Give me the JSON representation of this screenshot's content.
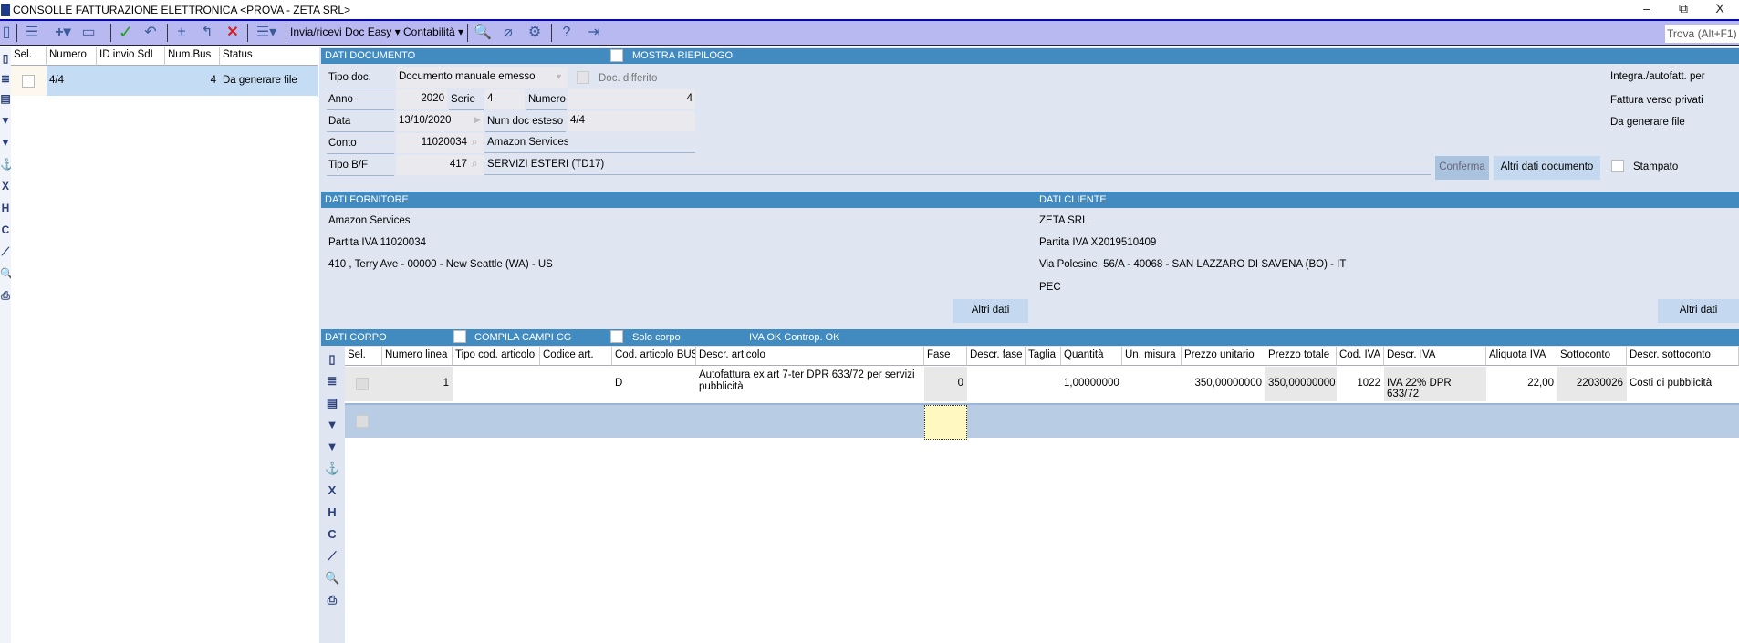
{
  "window": {
    "title": "CONSOLLE FATTURAZIONE ELETTRONICA <PROVA - ZETA SRL>",
    "minimize": "–",
    "restore": "⧉",
    "close": "X"
  },
  "toolbar": {
    "menu_doc_easy": "Invia/ricevi Doc Easy ▾",
    "menu_contabilita": "Contabilità ▾",
    "search_placeholder": "Trova (Alt+F1)"
  },
  "left_grid": {
    "columns": [
      "Sel.",
      "Numero",
      "ID invio SdI",
      "Num.Bus",
      "Status"
    ],
    "rows": [
      {
        "numero": "4/4",
        "id_invio": "",
        "num_bus": "4",
        "status": "Da generare file"
      }
    ]
  },
  "dati_documento": {
    "header": "DATI DOCUMENTO",
    "mostra_riepilogo": "MOSTRA RIEPILOGO",
    "tipo_doc_label": "Tipo doc.",
    "tipo_doc": "Documento manuale emesso",
    "doc_differito": "Doc. differito",
    "anno_label": "Anno",
    "anno": "2020",
    "serie_label": "Serie",
    "serie": "4",
    "numero_label": "Numero",
    "numero": "4",
    "data_label": "Data",
    "data": "13/10/2020",
    "num_doc_esteso_label": "Num doc esteso",
    "num_doc_esteso": "4/4",
    "conto_label": "Conto",
    "conto": "11020034",
    "conto_descr": "Amazon Services",
    "tipo_bf_label": "Tipo B/F",
    "tipo_bf": "417",
    "tipo_bf_descr": "SERVIZI ESTERI (TD17)",
    "conferma": "Conferma",
    "altri_dati_documento": "Altri dati documento",
    "stampato": "Stampato",
    "info": [
      "Integra./autofatt. per",
      "Fattura verso privati",
      "Da generare file"
    ]
  },
  "fornitore": {
    "header": "DATI FORNITORE",
    "nome": "Amazon Services",
    "piva": "Partita IVA 11020034",
    "indirizzo": "410 , Terry Ave - 00000 - New Seattle (WA)  - US",
    "altri_dati": "Altri dati"
  },
  "cliente": {
    "header": "DATI CLIENTE",
    "nome": "ZETA SRL",
    "piva": "Partita IVA X2019510409",
    "indirizzo": "Via Polesine, 56/A - 40068 - SAN LAZZARO DI SAVENA (BO)  - IT",
    "pec": "PEC",
    "altri_dati": "Altri dati"
  },
  "corpo": {
    "header": "DATI CORPO",
    "compila": "COMPILA CAMPI CG",
    "solo_corpo": "Solo corpo",
    "iva_ok": "IVA OK Controp. OK",
    "columns": [
      "Sel.",
      "Numero linea",
      "Tipo cod. articolo",
      "Codice art.",
      "Cod. articolo BUS",
      "Descr. articolo",
      "Fase",
      "Descr. fase",
      "Taglia",
      "Quantità",
      "Un. misura",
      "Prezzo unitario",
      "Prezzo totale",
      "Cod. IVA",
      "Descr. IVA",
      "Aliquota IVA",
      "Sottoconto",
      "Descr. sottoconto"
    ],
    "rows": [
      [
        "",
        "1",
        "",
        "",
        "D",
        "Autofattura ex art 7-ter DPR 633/72 per servizi pubblicità",
        "0",
        "",
        "",
        "1,00000000",
        "",
        "350,00000000",
        "350,00000000",
        "1022",
        "IVA 22% DPR 633/72",
        "22,00",
        "22030026",
        "Costi di pubblicità"
      ]
    ]
  }
}
